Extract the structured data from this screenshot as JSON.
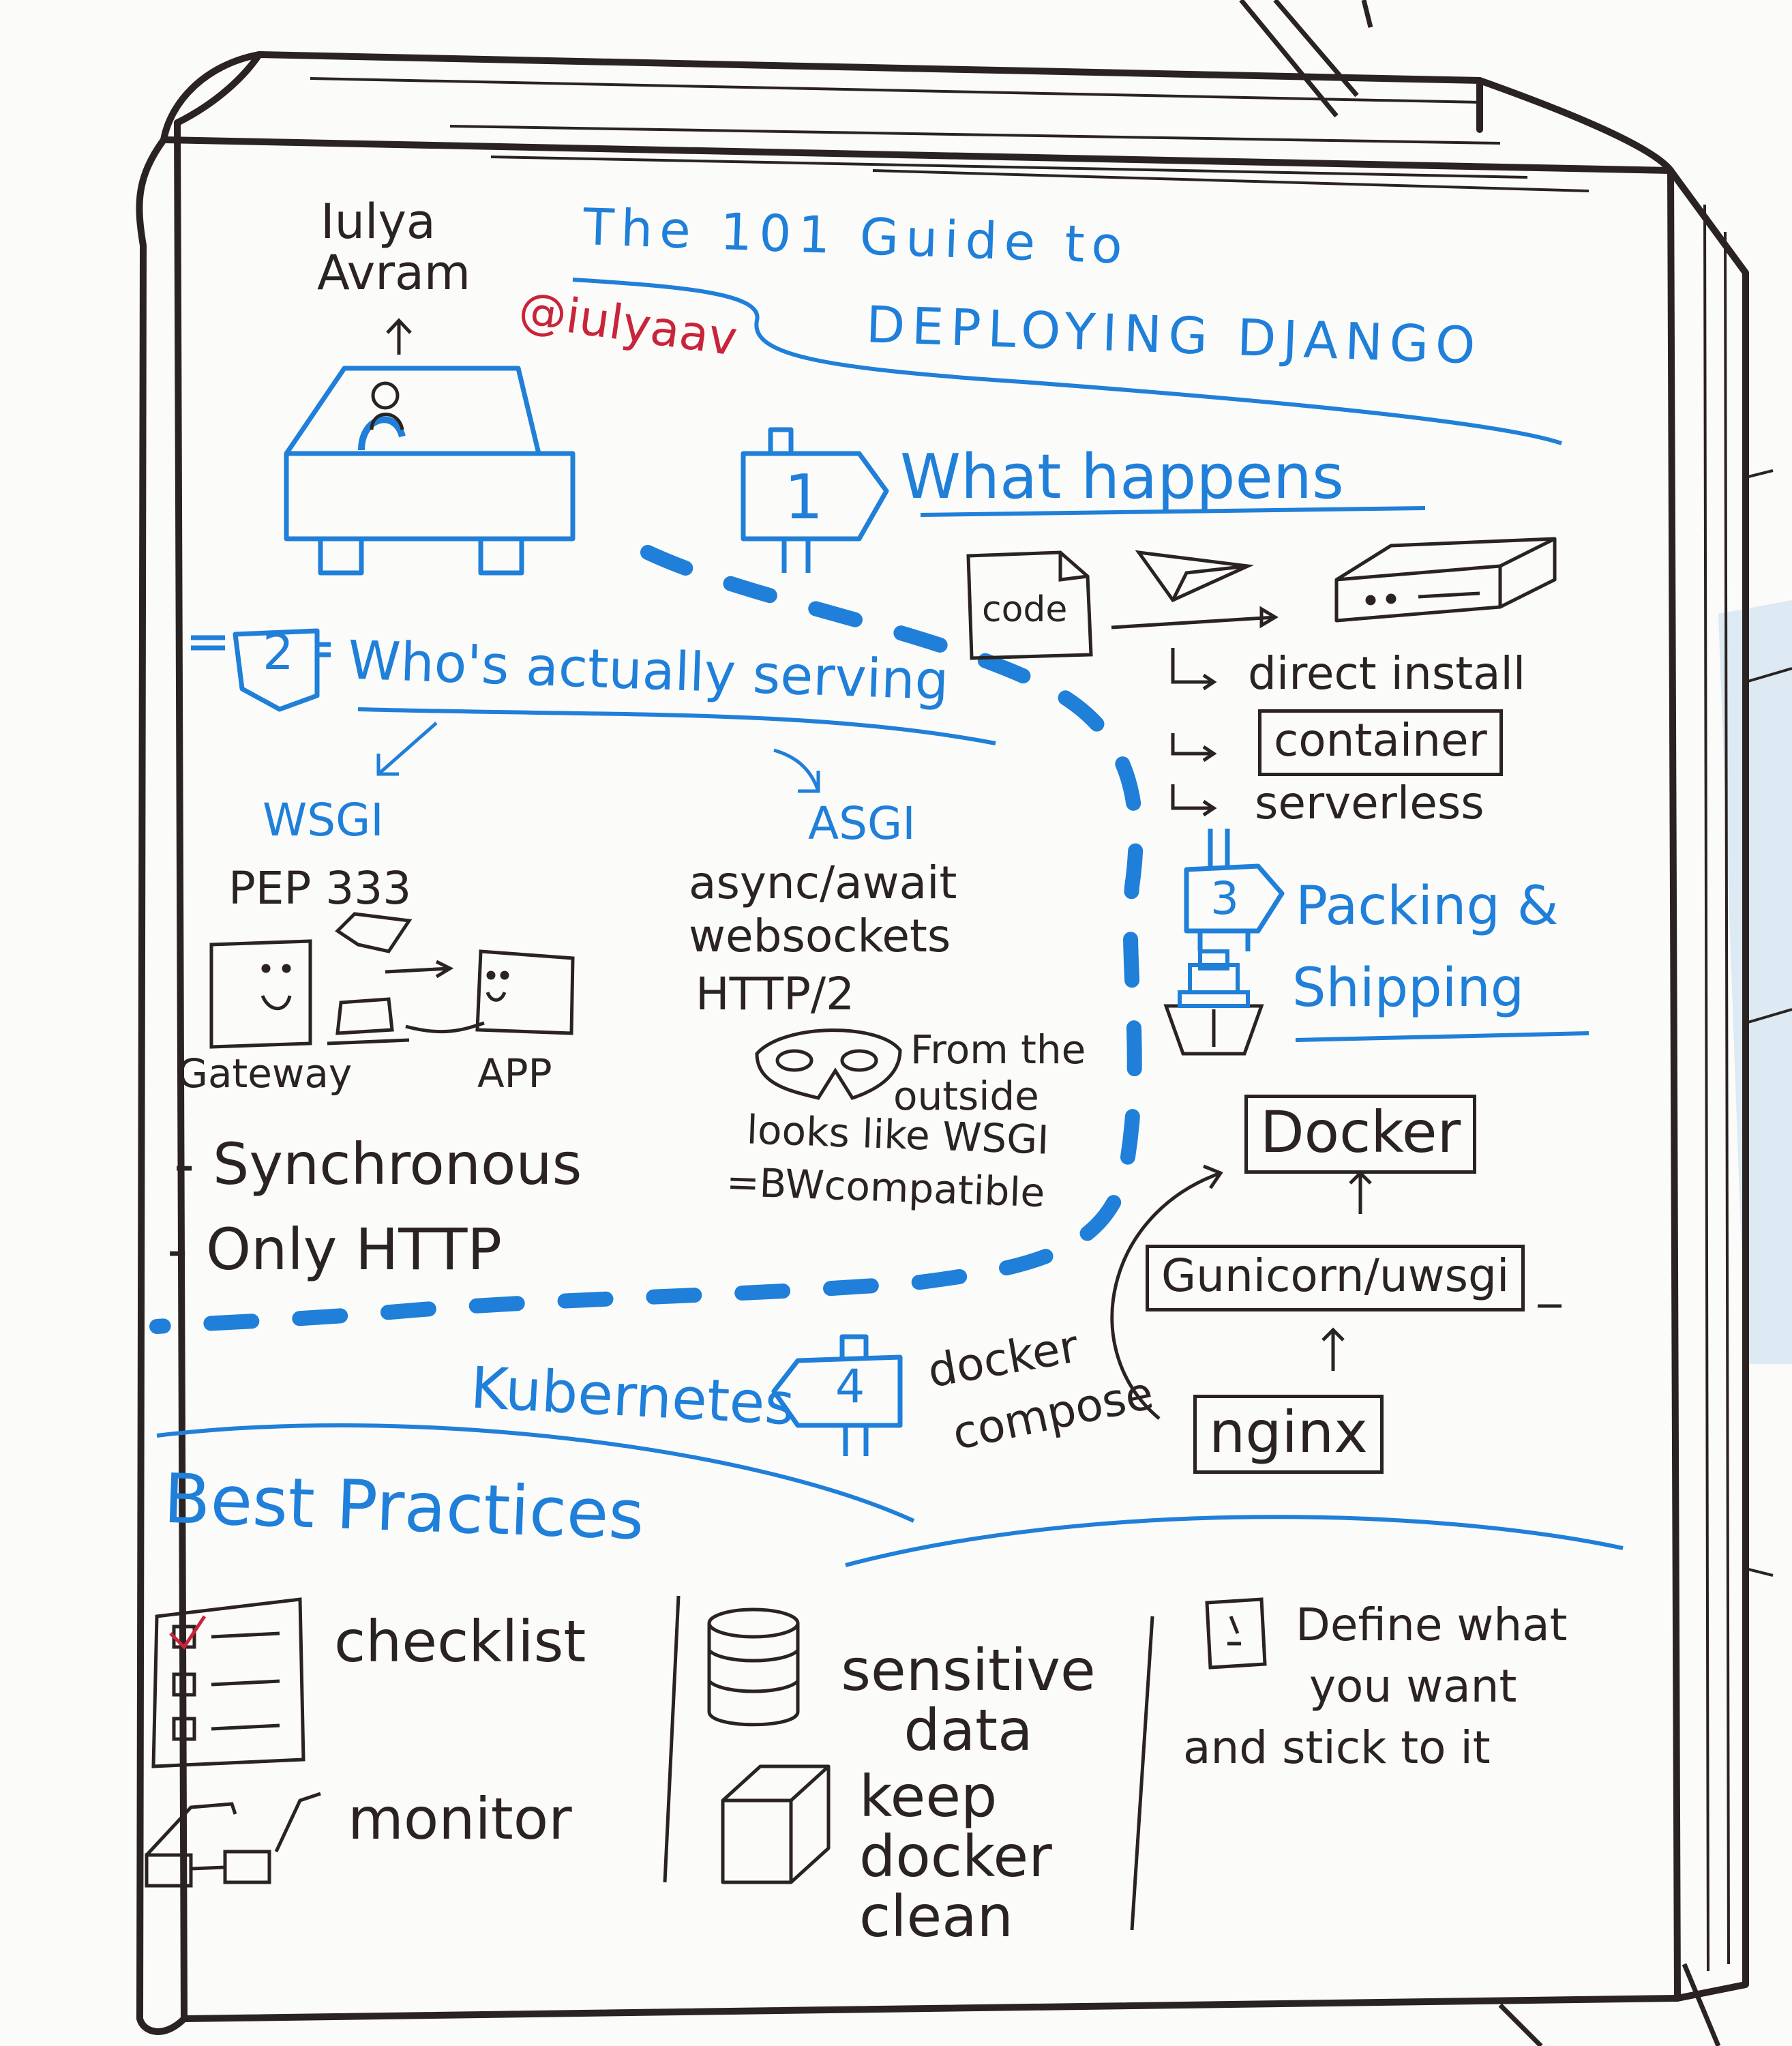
{
  "author": {
    "first_name": "Iulya",
    "last_name": "Avram",
    "handle": "@iulyaav"
  },
  "title": {
    "line1": "The 101 Guide to",
    "line2": "DEPLOYING DJANGO"
  },
  "section1": {
    "number": "1",
    "heading": "What happens",
    "code_label": "code",
    "options": [
      "direct install",
      "container",
      "serverless"
    ]
  },
  "section2": {
    "number": "2",
    "heading": "Who's actually serving",
    "wsgi": {
      "label": "WSGI",
      "pep": "PEP 333",
      "gateway": "Gateway",
      "app": "APP",
      "notes": [
        "- Synchronous",
        "- Only HTTP"
      ]
    },
    "asgi": {
      "label": "ASGI",
      "features": [
        "async/await",
        "websockets",
        "HTTP/2"
      ],
      "outside_note": [
        "From the",
        "outside",
        "looks like WSGI",
        "=BWcompatible"
      ]
    }
  },
  "section3": {
    "number": "3",
    "heading_line1": "Packing &",
    "heading_line2": "Shipping",
    "stack": [
      "Docker",
      "Gunicorn/uwsgi",
      "nginx"
    ],
    "docker_compose": [
      "docker",
      "compose"
    ]
  },
  "section4": {
    "number": "4",
    "label": "Kubernetes"
  },
  "best_practices": {
    "heading": "Best Practices",
    "items": [
      "checklist",
      "monitor",
      "sensitive data",
      "keep docker clean"
    ],
    "note": [
      "Define what",
      "you want",
      "and stick to it"
    ]
  },
  "colors": {
    "ink": "#2a2322",
    "blue": "#1f7fd9",
    "red": "#c8243a",
    "paper": "#fbfbf9",
    "background_tint": "#b9d3ea"
  }
}
